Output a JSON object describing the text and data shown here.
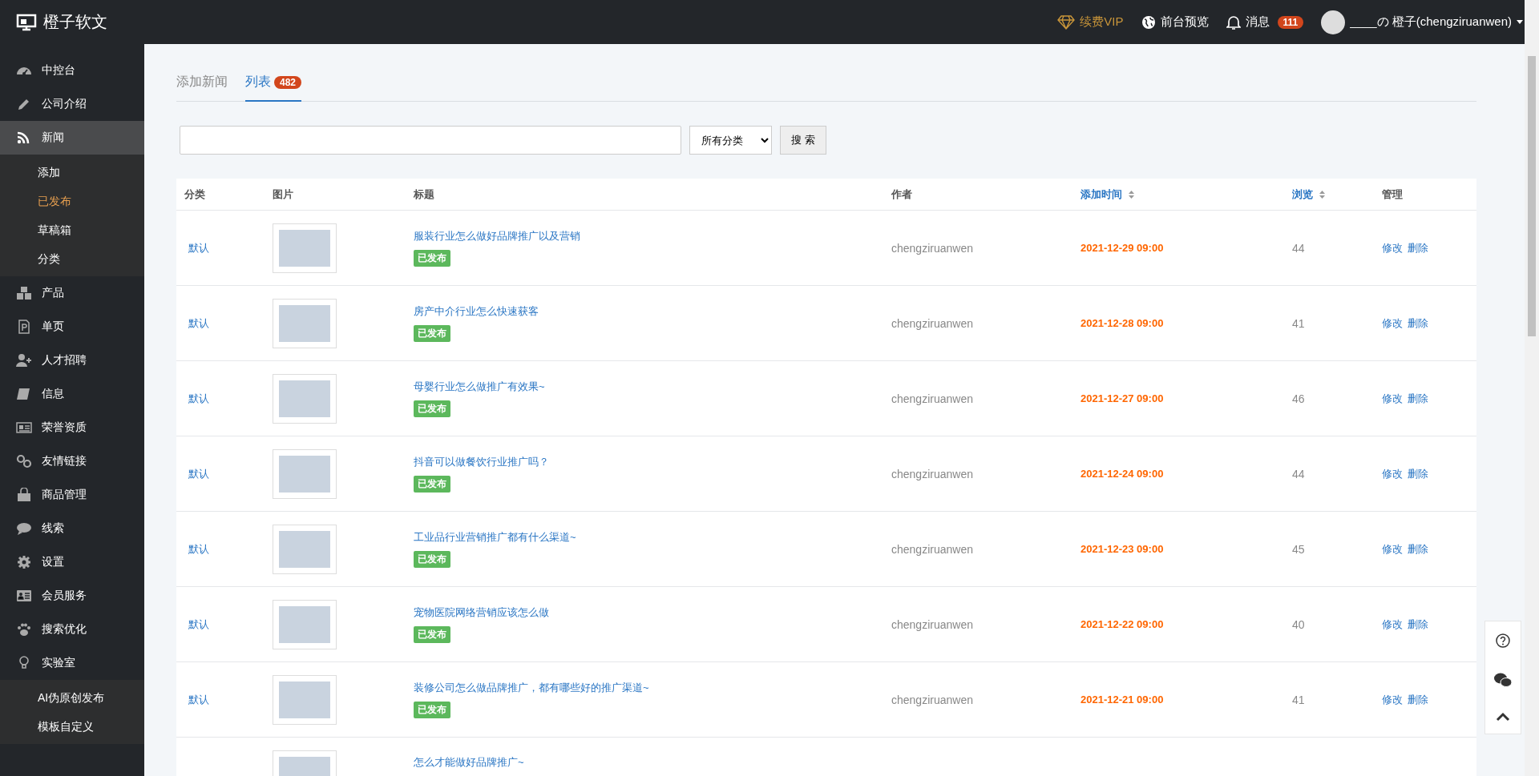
{
  "topbar": {
    "logo": "橙子软文",
    "vip": "续费VIP",
    "preview": "前台预览",
    "messages": {
      "label": "消息",
      "count": "111"
    },
    "user": "____の 橙子(chengziruanwen)"
  },
  "sidebar": {
    "items": [
      {
        "label": "中控台",
        "selected": false
      },
      {
        "label": "公司介绍",
        "selected": false
      },
      {
        "label": "新闻",
        "selected": true,
        "expanded": true,
        "children": [
          {
            "label": "添加",
            "selected": false
          },
          {
            "label": "已发布",
            "selected": true
          },
          {
            "label": "草稿箱",
            "selected": false
          },
          {
            "label": "分类",
            "selected": false
          }
        ]
      },
      {
        "label": "产品",
        "selected": false
      },
      {
        "label": "单页",
        "selected": false
      },
      {
        "label": "人才招聘",
        "selected": false
      },
      {
        "label": "信息",
        "selected": false
      },
      {
        "label": "荣誉资质",
        "selected": false
      },
      {
        "label": "友情链接",
        "selected": false
      },
      {
        "label": "商品管理",
        "selected": false
      },
      {
        "label": "线索",
        "selected": false
      },
      {
        "label": "设置",
        "selected": false
      },
      {
        "label": "会员服务",
        "selected": false
      },
      {
        "label": "搜索优化",
        "selected": false
      },
      {
        "label": "实验室",
        "selected": false,
        "expanded": true,
        "children": [
          {
            "label": "AI伪原创发布",
            "selected": false
          },
          {
            "label": "模板自定义",
            "selected": false
          }
        ]
      }
    ]
  },
  "tabs": [
    {
      "label": "添加新闻",
      "selected": false
    },
    {
      "label": "列表",
      "count": "482",
      "selected": true
    }
  ],
  "search": {
    "category": "所有分类",
    "button": "搜 索"
  },
  "table": {
    "columns": [
      {
        "label": "分类",
        "sortable": false
      },
      {
        "label": "图片",
        "sortable": false
      },
      {
        "label": "标题",
        "sortable": false
      },
      {
        "label": "作者",
        "sortable": false
      },
      {
        "label": "添加时间",
        "sortable": true
      },
      {
        "label": "浏览",
        "sortable": true
      },
      {
        "label": "管理",
        "sortable": false
      }
    ],
    "rows": [
      {
        "category": "默认",
        "title": "服装行业怎么做好品牌推广以及营销",
        "status": "已发布",
        "author": "chengziruanwen",
        "date": "2021-12-29 09:00",
        "views": "44",
        "edit": "修改",
        "delete": "删除"
      },
      {
        "category": "默认",
        "title": "房产中介行业怎么快速获客",
        "status": "已发布",
        "author": "chengziruanwen",
        "date": "2021-12-28 09:00",
        "views": "41",
        "edit": "修改",
        "delete": "删除"
      },
      {
        "category": "默认",
        "title": "母婴行业怎么做推广有效果~",
        "status": "已发布",
        "author": "chengziruanwen",
        "date": "2021-12-27 09:00",
        "views": "46",
        "edit": "修改",
        "delete": "删除"
      },
      {
        "category": "默认",
        "title": "抖音可以做餐饮行业推广吗？",
        "status": "已发布",
        "author": "chengziruanwen",
        "date": "2021-12-24 09:00",
        "views": "44",
        "edit": "修改",
        "delete": "删除"
      },
      {
        "category": "默认",
        "title": "工业品行业营销推广都有什么渠道~",
        "status": "已发布",
        "author": "chengziruanwen",
        "date": "2021-12-23 09:00",
        "views": "45",
        "edit": "修改",
        "delete": "删除"
      },
      {
        "category": "默认",
        "title": "宠物医院网络营销应该怎么做",
        "status": "已发布",
        "author": "chengziruanwen",
        "date": "2021-12-22 09:00",
        "views": "40",
        "edit": "修改",
        "delete": "删除"
      },
      {
        "category": "默认",
        "title": "装修公司怎么做品牌推广，都有哪些好的推广渠道~",
        "status": "已发布",
        "author": "chengziruanwen",
        "date": "2021-12-21 09:00",
        "views": "41",
        "edit": "修改",
        "delete": "删除"
      },
      {
        "title": "怎么才能做好品牌推广~"
      }
    ]
  }
}
